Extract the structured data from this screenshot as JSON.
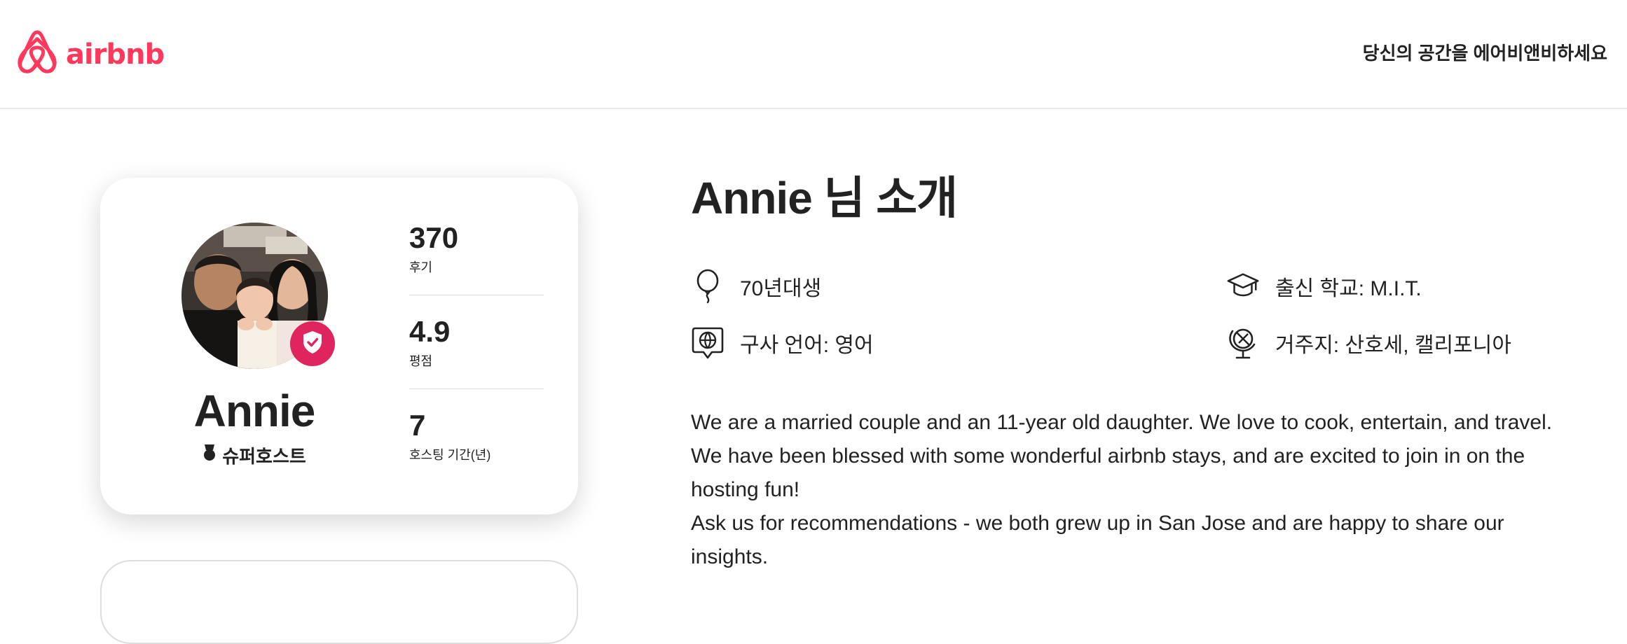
{
  "header": {
    "logo_text": "airbnb",
    "host_link": "당신의 공간을 에어비앤비하세요"
  },
  "profile": {
    "name": "Annie",
    "superhost_label": "슈퍼호스트",
    "stats": [
      {
        "value": "370",
        "label": "후기"
      },
      {
        "value": "4.9",
        "label": "평점"
      },
      {
        "value": "7",
        "label": "호스팅 기간(년)"
      }
    ]
  },
  "about": {
    "title": "Annie 님 소개",
    "facts": {
      "born": "70년대생",
      "school": "출신 학교: M.I.T.",
      "language": "구사 언어: 영어",
      "location": "거주지: 산호세, 캘리포니아"
    },
    "bio": [
      "We are a married couple and an 11-year old daughter. We love to cook, entertain, and travel. We have been blessed with some wonderful airbnb stays, and are excited to join in on the hosting fun!",
      "Ask us for recommendations - we both grew up in San Jose and are happy to share our insights."
    ]
  },
  "colors": {
    "brand": "#ff385c",
    "badge": "#e0245e",
    "text": "#222222"
  },
  "icons": {
    "logo": "airbnb-belo-icon",
    "verified": "shield-check-icon",
    "superhost": "medal-icon",
    "born": "balloon-icon",
    "school": "graduation-cap-icon",
    "language": "globe-speech-icon",
    "location": "globe-stand-icon"
  }
}
